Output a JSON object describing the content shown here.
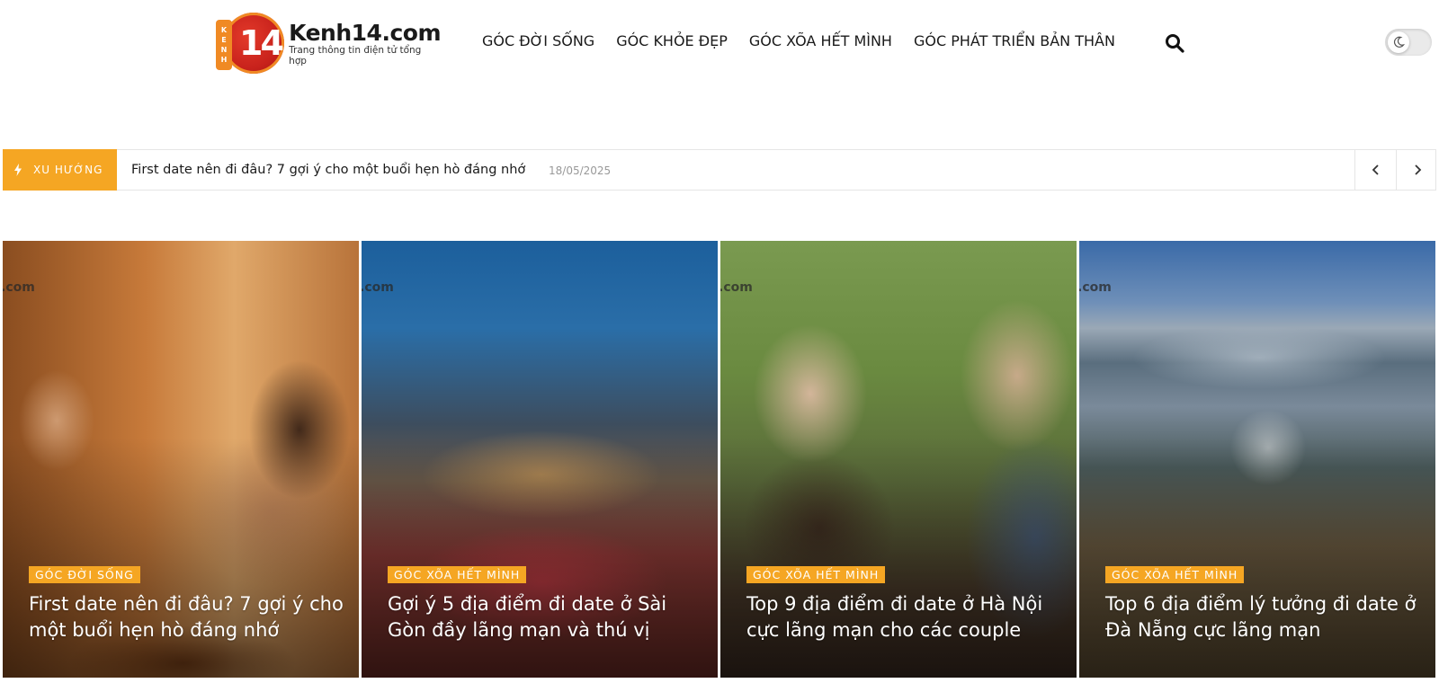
{
  "site": {
    "logo_number": "14",
    "logo_strip": [
      "K",
      "E",
      "N",
      "H"
    ],
    "logo_title": "Kenh14.com",
    "logo_tagline": "Trang thông tin điện tử tổng hợp"
  },
  "nav": {
    "items": [
      {
        "label": "GÓC ĐỜI SỐNG"
      },
      {
        "label": "GÓC KHỎE ĐẸP"
      },
      {
        "label": "GÓC XÕA HẾT MÌNH"
      },
      {
        "label": "GÓC PHÁT TRIỂN BẢN THÂN"
      }
    ],
    "search_icon": "search-icon",
    "theme_toggle_icon": "moon-icon"
  },
  "trending": {
    "label": "XU HƯỚNG",
    "label_icon": "lightning-icon",
    "headline": "First date nên đi đâu? 7 gợi ý cho một buổi hẹn hò đáng nhớ",
    "date": "18/05/2025"
  },
  "cards": [
    {
      "category": "GÓC ĐỜI SỐNG",
      "title": "First date nên đi đâu? 7 gợi ý cho một buổi hẹn hò đáng nhớ",
      "watermark": ".com"
    },
    {
      "category": "GÓC XÕA HẾT MÌNH",
      "title": "Gợi ý 5 địa điểm đi date ở Sài Gòn đầy lãng mạn và thú vị",
      "watermark": ".com"
    },
    {
      "category": "GÓC XÕA HẾT MÌNH",
      "title": "Top 9 địa điểm đi date ở Hà Nội cực lãng mạn cho các couple",
      "watermark": ".com"
    },
    {
      "category": "GÓC XÕA HẾT MÌNH",
      "title": "Top 6 địa điểm lý tưởng đi date ở Đà Nẵng cực lãng mạn",
      "watermark": ".com"
    }
  ],
  "colors": {
    "accent": "#f5a623",
    "logo_red": "#c8221c",
    "logo_orange": "#f08a24"
  }
}
